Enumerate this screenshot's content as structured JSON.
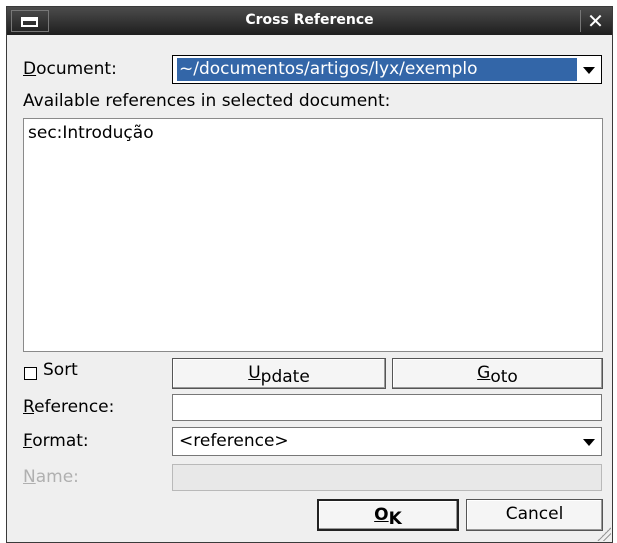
{
  "window": {
    "title": "Cross Reference",
    "close_glyph": "✕"
  },
  "document": {
    "label_key": "D",
    "label_rest": "ocument:",
    "value": "~/documentos/artigos/lyx/exemplo"
  },
  "references": {
    "heading": "Available references in selected document:",
    "items": [
      "sec:Introdução"
    ]
  },
  "sort": {
    "label": "Sort",
    "checked": false
  },
  "buttons": {
    "update_key": "U",
    "update_rest": "pdate",
    "goto_key": "G",
    "goto_rest": "oto",
    "ok_key": "O",
    "ok_rest": "K",
    "cancel": "Cancel"
  },
  "reference": {
    "label_key": "R",
    "label_rest": "eference:",
    "value": ""
  },
  "format": {
    "label_key": "F",
    "label_rest": "ormat:",
    "value": "<reference>"
  },
  "name": {
    "label_key": "N",
    "label_rest": "ame:",
    "value": "",
    "disabled": true
  }
}
